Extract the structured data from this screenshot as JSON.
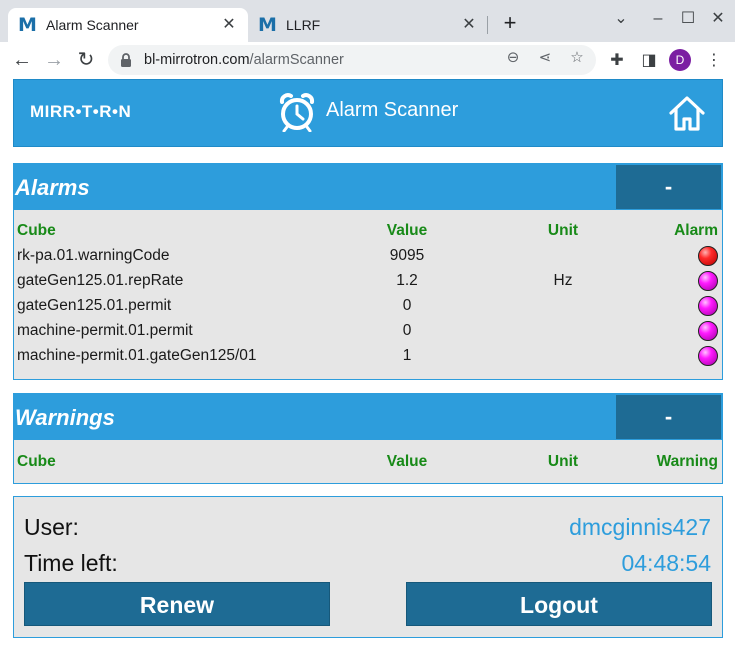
{
  "browser": {
    "tabs": [
      {
        "title": "Alarm Scanner",
        "favicon": "M"
      },
      {
        "title": "LLRF",
        "favicon": "M"
      }
    ],
    "url_host": "bl-mirrotron.com",
    "url_path": "/alarmScanner",
    "profile_initial": "D"
  },
  "header": {
    "logo": "MIRR•T•R•N",
    "title": "Alarm Scanner"
  },
  "alarms": {
    "title": "Alarms",
    "collapse_label": "-",
    "columns": {
      "cube": "Cube",
      "value": "Value",
      "unit": "Unit",
      "status": "Alarm"
    },
    "rows": [
      {
        "cube": "rk-pa.01.warningCode",
        "value": "9095",
        "unit": "",
        "led": "red"
      },
      {
        "cube": "gateGen125.01.repRate",
        "value": "1.2",
        "unit": "Hz",
        "led": "magenta"
      },
      {
        "cube": "gateGen125.01.permit",
        "value": "0",
        "unit": "",
        "led": "magenta"
      },
      {
        "cube": "machine-permit.01.permit",
        "value": "0",
        "unit": "",
        "led": "magenta"
      },
      {
        "cube": "machine-permit.01.gateGen125/01",
        "value": "1",
        "unit": "",
        "led": "magenta"
      }
    ]
  },
  "warnings": {
    "title": "Warnings",
    "collapse_label": "-",
    "columns": {
      "cube": "Cube",
      "value": "Value",
      "unit": "Unit",
      "status": "Warning"
    }
  },
  "session": {
    "user_label": "User:",
    "user_value": "dmcginnis427",
    "time_label": "Time left:",
    "time_value": "04:48:54",
    "renew_label": "Renew",
    "logout_label": "Logout"
  },
  "colors": {
    "header_blue": "#2d9ddc",
    "button_dark_blue": "#1e6b94",
    "column_header_green": "#188a18",
    "panel_gray": "#e6e6e6"
  }
}
